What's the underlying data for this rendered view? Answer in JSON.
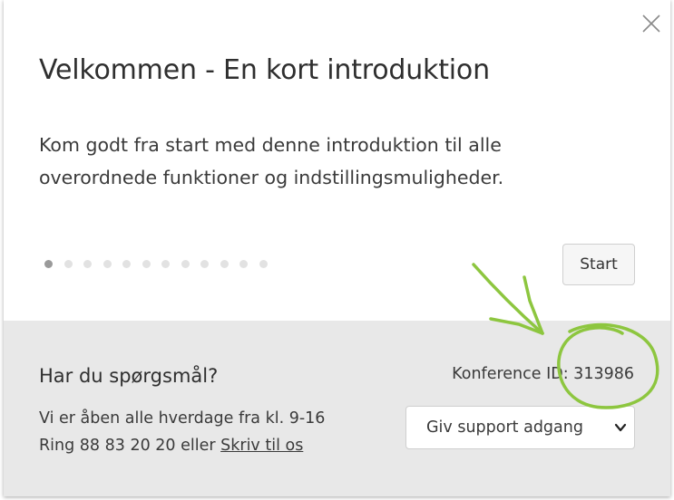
{
  "dialog": {
    "title": "Velkommen - En kort introduktion",
    "description": "Kom godt fra start med denne introduktion til alle overordnede funktioner og indstillingsmuligheder.",
    "close_icon": "close-icon",
    "pager": {
      "total": 12,
      "active_index": 0
    },
    "start_label": "Start"
  },
  "footer": {
    "question_title": "Har du spørgsmål?",
    "hours_line": "Vi er åben alle hverdage fra kl. 9-16",
    "phone_text": "Ring 88 83 20 20 eller ",
    "contact_link": "Skriv til os",
    "conference_id": "Konference ID: 313986",
    "support_select": {
      "selected": "Giv support adgang",
      "icon": "chevron-down-icon"
    }
  },
  "colors": {
    "footer_bg": "#e8e8e8",
    "annotation": "#8dc63f",
    "dot_active": "#9a9a9a",
    "dot_inactive": "#e2e2e2"
  }
}
